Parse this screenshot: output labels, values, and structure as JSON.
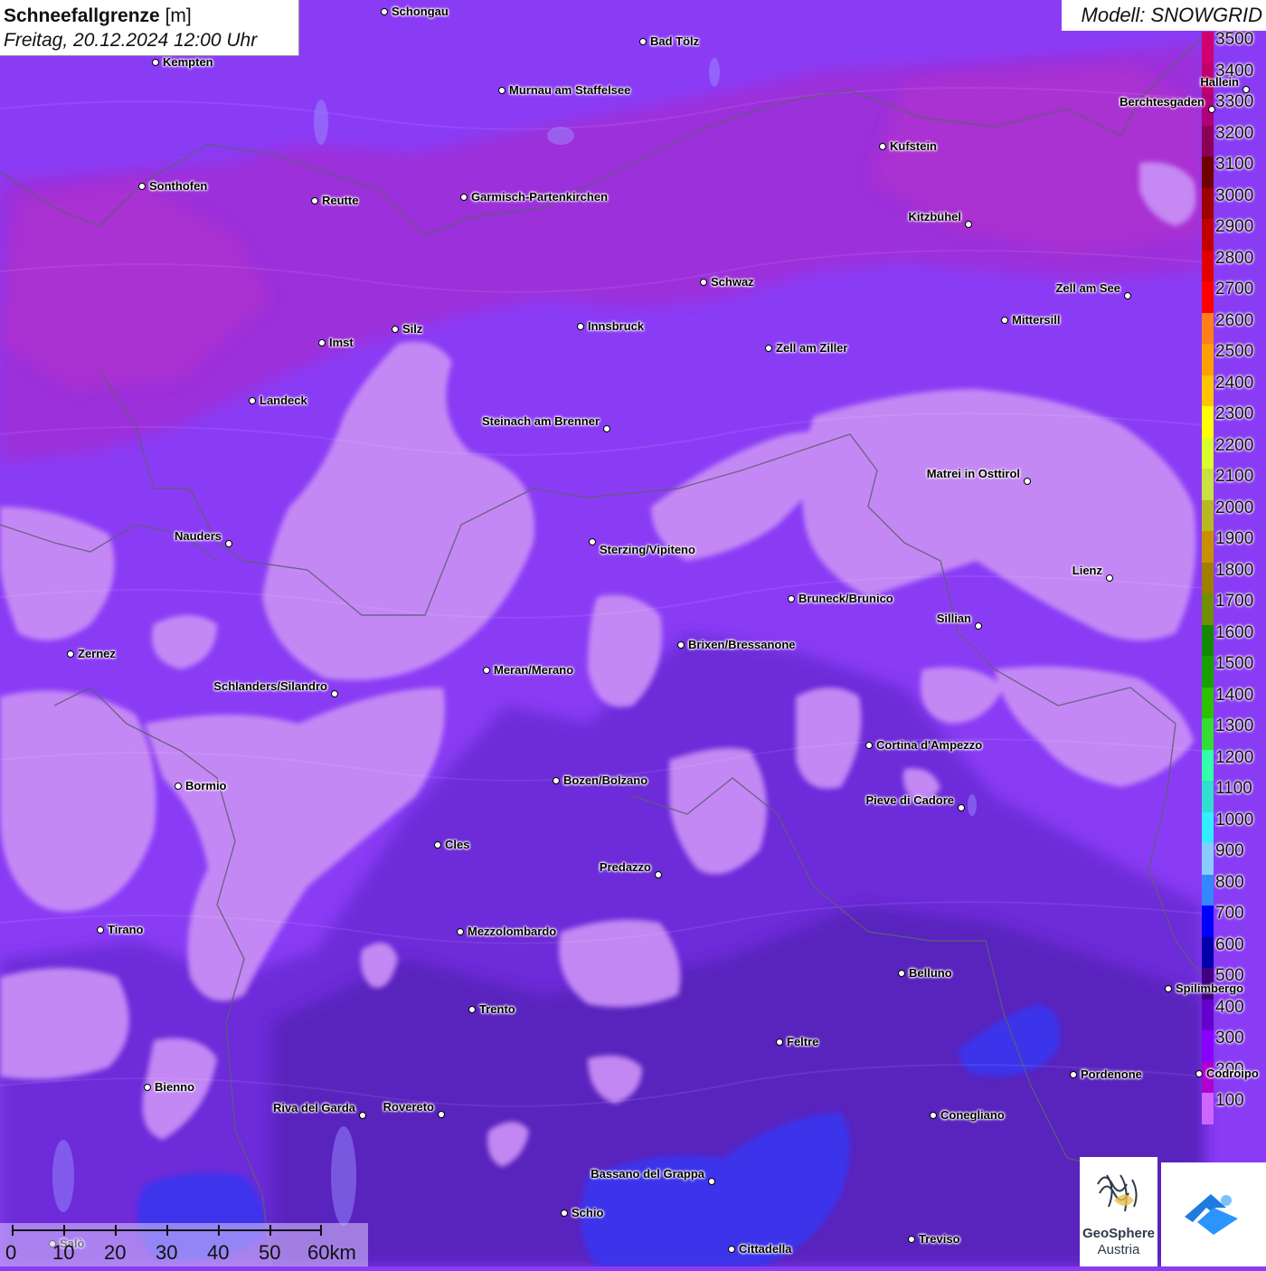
{
  "title": {
    "bold": "Schneefallgrenze",
    "unit": "[m]",
    "date": "Freitag, 20.12.2024 12:00 Uhr"
  },
  "model": "Modell: SNOWGRID",
  "legend": {
    "labels": [
      "3500",
      "3400",
      "3300",
      "3200",
      "3100",
      "3000",
      "2900",
      "2800",
      "2700",
      "2600",
      "2500",
      "2400",
      "2300",
      "2200",
      "2100",
      "2000",
      "1900",
      "1800",
      "1700",
      "1600",
      "1500",
      "1400",
      "1300",
      "1200",
      "1100",
      "1000",
      "900",
      "800",
      "700",
      "600",
      "500",
      "400",
      "300",
      "200",
      "100"
    ],
    "colors": [
      "#d0006f",
      "#c2006b",
      "#b0007a",
      "#8b0057",
      "#6e0000",
      "#9e0000",
      "#c00000",
      "#e00000",
      "#ff0000",
      "#ff7f1a",
      "#ff9f00",
      "#ffc300",
      "#ffff00",
      "#d8ff2a",
      "#c8e040",
      "#b8b820",
      "#c89000",
      "#a07e00",
      "#6f9000",
      "#138a00",
      "#18a000",
      "#2bc000",
      "#33dd33",
      "#33ffaa",
      "#33ddd0",
      "#33eeff",
      "#88ccff",
      "#3388ff",
      "#0000ff",
      "#0000aa",
      "#400080",
      "#6600cc",
      "#8800ff",
      "#b000d0",
      "#cc66ff"
    ]
  },
  "cities": [
    {
      "name": "Schongau"
    },
    {
      "name": "Bad Tölz"
    },
    {
      "name": "Kempten"
    },
    {
      "name": "Murnau am Staffelsee"
    },
    {
      "name": "Hallein"
    },
    {
      "name": "Berchtesgaden"
    },
    {
      "name": "Kufstein"
    },
    {
      "name": "Sonthofen"
    },
    {
      "name": "Reutte"
    },
    {
      "name": "Garmisch-Partenkirchen"
    },
    {
      "name": "Kitzbühel"
    },
    {
      "name": "Schwaz"
    },
    {
      "name": "Zell am See"
    },
    {
      "name": "Mittersill"
    },
    {
      "name": "Innsbruck"
    },
    {
      "name": "Imst"
    },
    {
      "name": "Silz"
    },
    {
      "name": "Zell am Ziller"
    },
    {
      "name": "Landeck"
    },
    {
      "name": "Steinach am Brenner"
    },
    {
      "name": "Matrei in Osttirol"
    },
    {
      "name": "Nauders"
    },
    {
      "name": "Sterzing/Vipiteno"
    },
    {
      "name": "Lienz"
    },
    {
      "name": "Bruneck/Brunico"
    },
    {
      "name": "Sillian"
    },
    {
      "name": "Zernez"
    },
    {
      "name": "Brixen/Bressanone"
    },
    {
      "name": "Meran/Merano"
    },
    {
      "name": "Schlanders/Silandro"
    },
    {
      "name": "Cortina d'Ampezzo"
    },
    {
      "name": "Bormio"
    },
    {
      "name": "Bozen/Bolzano"
    },
    {
      "name": "Pieve di Cadore"
    },
    {
      "name": "Cles"
    },
    {
      "name": "Predazzo"
    },
    {
      "name": "Tirano"
    },
    {
      "name": "Mezzolombardo"
    },
    {
      "name": "Belluno"
    },
    {
      "name": "Spilimbergo"
    },
    {
      "name": "Trento"
    },
    {
      "name": "Feltre"
    },
    {
      "name": "Pordenone"
    },
    {
      "name": "Codroipo"
    },
    {
      "name": "Bienno"
    },
    {
      "name": "Riva del Garda"
    },
    {
      "name": "Rovereto"
    },
    {
      "name": "Conegliano"
    },
    {
      "name": "Bassano del Grappa"
    },
    {
      "name": "Schio"
    },
    {
      "name": "Salò"
    },
    {
      "name": "Treviso"
    },
    {
      "name": "Cittadella"
    }
  ],
  "scale": {
    "ticks": [
      "0",
      "10",
      "20",
      "30",
      "40",
      "50",
      "60km"
    ]
  },
  "logo": {
    "line1": "GeoSphere",
    "line2": "Austria"
  }
}
